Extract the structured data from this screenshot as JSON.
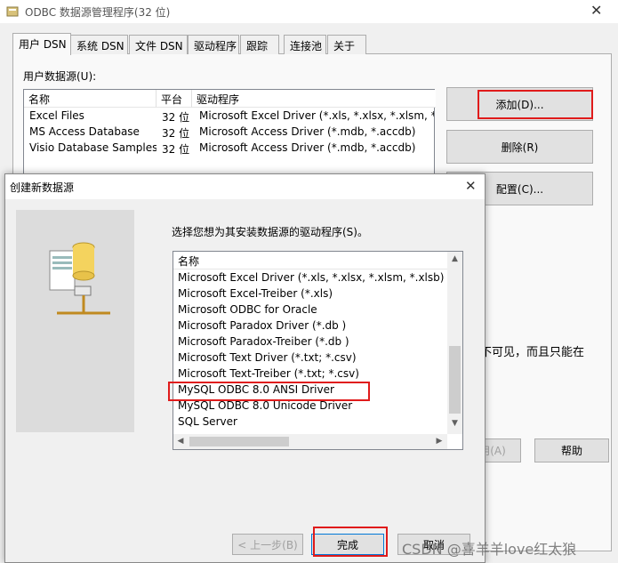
{
  "main": {
    "title": "ODBC 数据源管理程序(32 位)",
    "tabs": [
      "用户 DSN",
      "系统 DSN",
      "文件 DSN",
      "驱动程序",
      "跟踪",
      "连接池",
      "关于"
    ],
    "list_label": "用户数据源(U):",
    "columns": [
      "名称",
      "平台",
      "驱动程序"
    ],
    "rows": [
      {
        "name": "Excel Files",
        "platform": "32 位",
        "driver": "Microsoft Excel Driver (*.xls, *.xlsx, *.xlsm, *.xlsb)"
      },
      {
        "name": "MS Access Database",
        "platform": "32 位",
        "driver": "Microsoft Access Driver (*.mdb, *.accdb)"
      },
      {
        "name": "Visio Database Samples",
        "platform": "32 位",
        "driver": "Microsoft Access Driver (*.mdb, *.accdb)"
      }
    ],
    "buttons": {
      "add": "添加(D)...",
      "remove": "删除(R)",
      "configure": "配置(C)...",
      "apply": "应用(A)",
      "help": "帮助"
    },
    "info_fragment": "不可见，而且只能在",
    "close_glyph": "✕"
  },
  "dialog": {
    "title": "创建新数据源",
    "close_glyph": "✕",
    "prompt": "选择您想为其安装数据源的驱动程序(S)。",
    "column": "名称",
    "drivers": [
      "Microsoft Excel Driver (*.xls, *.xlsx, *.xlsm, *.xlsb)",
      "Microsoft Excel-Treiber (*.xls)",
      "Microsoft ODBC for Oracle",
      "Microsoft Paradox Driver (*.db )",
      "Microsoft Paradox-Treiber (*.db )",
      "Microsoft Text Driver (*.txt; *.csv)",
      "Microsoft Text-Treiber (*.txt; *.csv)",
      "MySQL ODBC 8.0 ANSI Driver",
      "MySQL ODBC 8.0 Unicode Driver",
      "SQL Server"
    ],
    "buttons": {
      "back": "< 上一步(B)",
      "finish": "完成",
      "cancel": "取消"
    }
  },
  "watermark": "CSDN @喜羊羊love红太狼",
  "colors": {
    "highlight_box": "#e01b1b",
    "title_text": "#555555"
  }
}
